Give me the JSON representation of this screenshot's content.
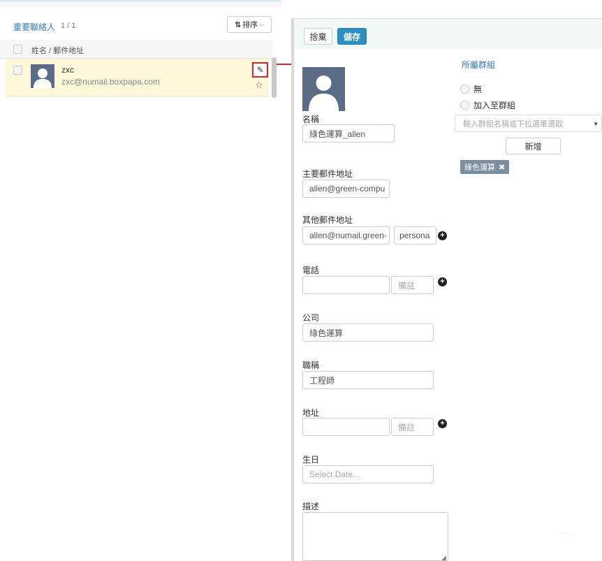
{
  "contact_list": {
    "title": "重要聯絡人",
    "count": "1 / 1",
    "sort_label": "排序",
    "sort_icon": "sort-arrows-icon",
    "header_label": "姓名 / 郵件地址",
    "contacts": [
      {
        "name": "zxc",
        "email": "zxc@numail.boxpapa.com",
        "favorite": false,
        "selected": false
      }
    ]
  },
  "form": {
    "discard_label": "捨棄",
    "save_label": "儲存",
    "name_label": "名稱",
    "name_value": "綠色運算_allen",
    "primary_email_label": "主要郵件地址",
    "primary_email_value": "allen@green-compu",
    "other_email_label": "其他郵件地址",
    "other_email_value": "allen@numail.green-",
    "other_email_type": "persona",
    "phone_label": "電話",
    "phone_value": "",
    "phone_note_placeholder": "備註",
    "company_label": "公司",
    "company_value": "綠色運算",
    "title_label": "職稱",
    "title_value": "工程師",
    "address_label": "地址",
    "address_value": "",
    "address_note_placeholder": "備註",
    "birthday_label": "生日",
    "birthday_placeholder": "Select Date...",
    "description_label": "描述",
    "description_value": ""
  },
  "groups": {
    "title": "所屬群組",
    "option_none": "無",
    "option_join": "加入至群組",
    "select_placeholder": "輸入群組名稱或下拉選單選取",
    "add_label": "新增",
    "tags": [
      "綠色運算"
    ]
  },
  "colors": {
    "link_blue": "#337ab7",
    "save_blue": "#2c8fc2",
    "highlight_red": "#d9262d",
    "row_highlight": "#fdf8da",
    "tag_gray": "#7a8ea0"
  }
}
